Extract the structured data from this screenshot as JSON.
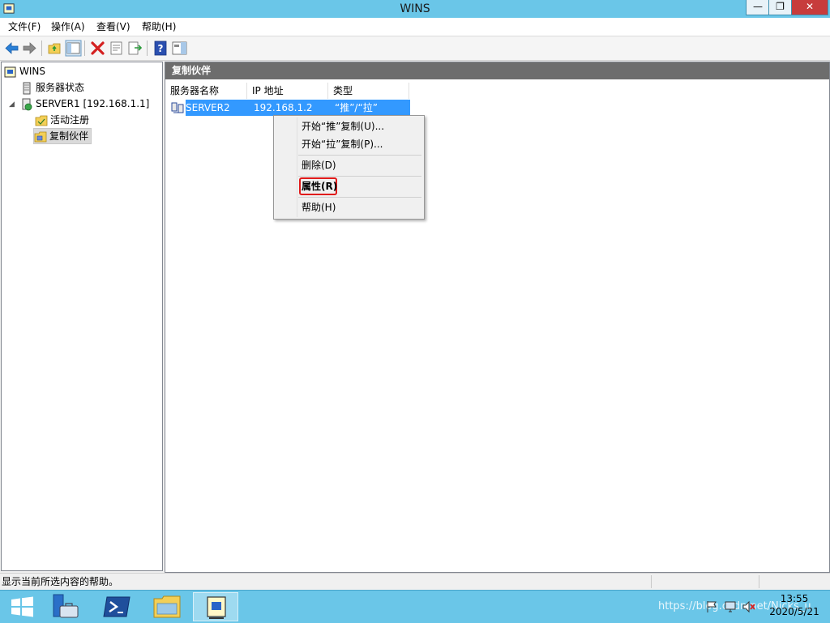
{
  "window": {
    "title": "WINS",
    "app_icon": "wins-scroll-icon",
    "minimize_glyph": "—",
    "maximize_glyph": "❐",
    "close_glyph": "✕"
  },
  "menubar": [
    "文件(F)",
    "操作(A)",
    "查看(V)",
    "帮助(H)"
  ],
  "toolbar": [
    "back-arrow-icon",
    "forward-arrow-icon",
    "up-folder-icon",
    "show-hide-console-tree-icon",
    "delete-icon",
    "properties-icon",
    "export-list-icon",
    "help-icon",
    "show-hide-action-pane-icon"
  ],
  "tree": {
    "root": "WINS",
    "server_status": "服务器状态",
    "server": "SERVER1 [192.168.1.1]",
    "server_expander": "◢",
    "active_registrations": "活动注册",
    "replication_partners": "复制伙伴"
  },
  "right_pane": {
    "header": "复制伙伴",
    "columns": [
      "服务器名称",
      "IP 地址",
      "类型"
    ],
    "rows": [
      {
        "name": "SERVER2",
        "ip": "192.168.1.2",
        "type": "“推”/“拉”"
      }
    ]
  },
  "context_menu": {
    "items": [
      "开始“推”复制(U)...",
      "开始“拉”复制(P)...",
      "删除(D)",
      "属性(R)",
      "帮助(H)"
    ],
    "highlighted": "属性(R)",
    "highlight_color": "#e01b1b"
  },
  "statusbar": {
    "text": "显示当前所选内容的帮助。"
  },
  "taskbar": {
    "buttons": [
      "start-windows-icon",
      "server-manager-icon",
      "powershell-icon",
      "file-explorer-icon",
      "wins-scroll-icon"
    ],
    "watermark": "https://blog.csdn.net/Nicks_u",
    "time": "13:55",
    "date": "2020/5/21"
  },
  "colors": {
    "titlebar": "#6ac6e8",
    "selection": "#3399ff",
    "pane_header": "#6d6d6d"
  }
}
